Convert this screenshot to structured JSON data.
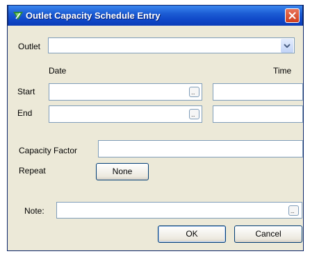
{
  "window": {
    "title": "Outlet Capacity Schedule Entry"
  },
  "outlet": {
    "label": "Outlet",
    "value": ""
  },
  "header": {
    "date": "Date",
    "time": "Time"
  },
  "start": {
    "label": "Start",
    "date_value": "",
    "time_value": ""
  },
  "end": {
    "label": "End",
    "date_value": "",
    "time_value": ""
  },
  "capacity": {
    "label": "Capacity Factor",
    "value": ""
  },
  "repeat": {
    "label": "Repeat",
    "button": "None"
  },
  "note": {
    "label": "Note:",
    "value": ""
  },
  "picker": {
    "glyph": "..."
  },
  "buttons": {
    "ok": "OK",
    "cancel": "Cancel"
  },
  "colors": {
    "title_bar": "#1c5cd4",
    "close_button": "#d13f1c",
    "window_bg": "#ece9d8"
  }
}
